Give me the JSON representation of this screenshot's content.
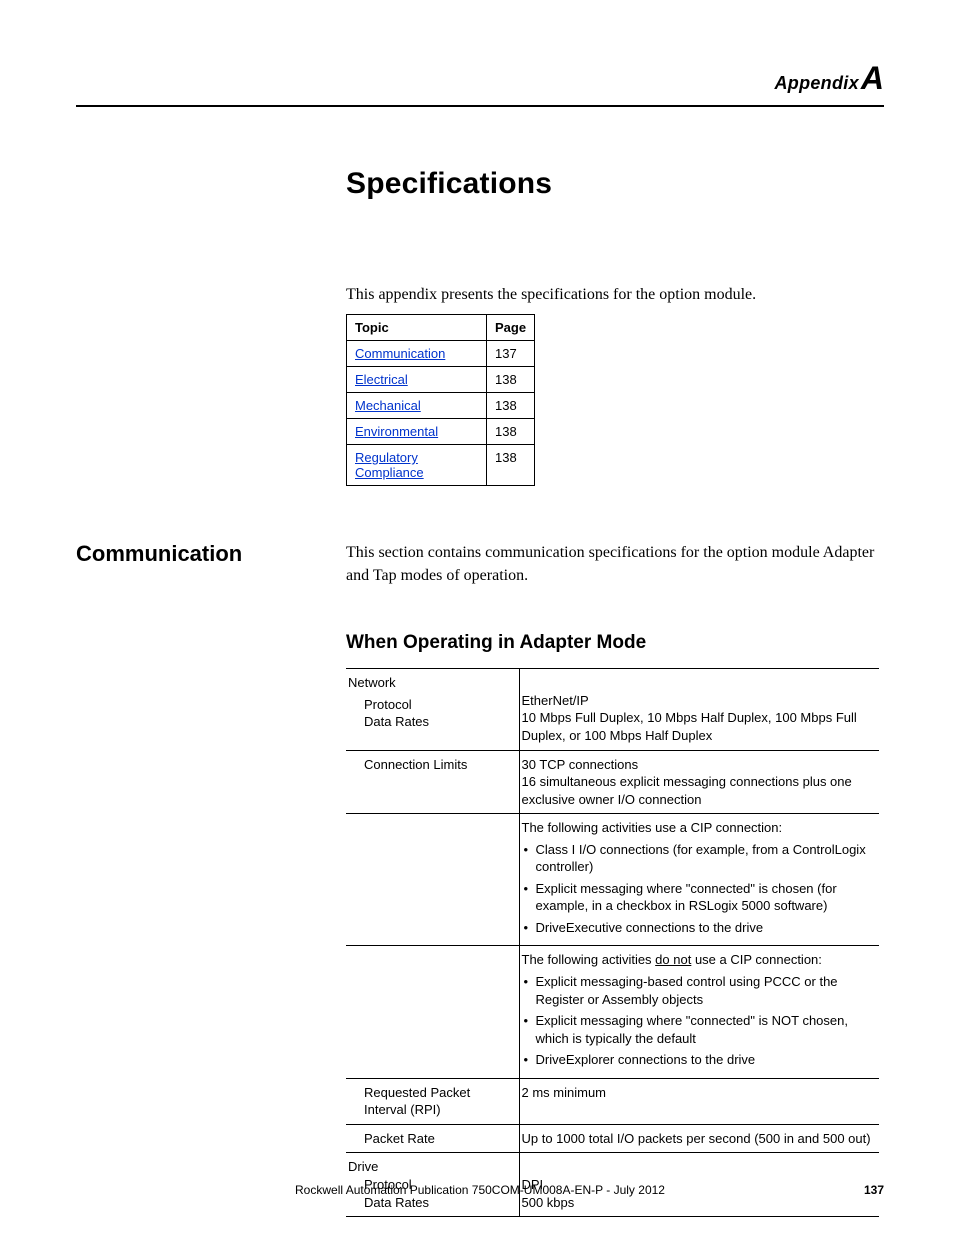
{
  "header": {
    "appendix_word": "Appendix",
    "appendix_letter": "A"
  },
  "chapter_title": "Specifications",
  "intro": "This appendix presents the specifications for the option module.",
  "topic_table": {
    "headers": {
      "topic": "Topic",
      "page": "Page"
    },
    "rows": [
      {
        "topic": "Communication",
        "page": "137"
      },
      {
        "topic": "Electrical",
        "page": "138"
      },
      {
        "topic": "Mechanical",
        "page": "138"
      },
      {
        "topic": "Environmental",
        "page": "138"
      },
      {
        "topic": "Regulatory Compliance",
        "page": "138"
      }
    ]
  },
  "section": {
    "label": "Communication",
    "text": "This section contains communication specifications for the option module Adapter and Tap modes of operation."
  },
  "subhead": "When Operating in Adapter Mode",
  "spec": {
    "network_label": "Network",
    "protocol_label": "Protocol",
    "protocol_value": "EtherNet/IP",
    "data_rates_label": "Data Rates",
    "data_rates_value": "10 Mbps Full Duplex, 10 Mbps Half Duplex, 100 Mbps Full Duplex, or 100 Mbps Half Duplex",
    "conn_limits_label": "Connection Limits",
    "conn_limits_line1": "30 TCP connections",
    "conn_limits_line2": "16 simultaneous explicit messaging connections plus one exclusive owner I/O connection",
    "cip_use_intro": "The following activities use a CIP connection:",
    "cip_use_bullets": [
      "Class I I/O connections (for example, from a ControlLogix controller)",
      "Explicit messaging where \"connected\" is chosen (for example, in a checkbox in RSLogix 5000 software)",
      "DriveExecutive connections to the drive"
    ],
    "cip_not_intro_pre": "The following activities ",
    "cip_not_intro_underline": "do not",
    "cip_not_intro_post": " use a CIP connection:",
    "cip_not_bullets": [
      "Explicit messaging-based control using PCCC or the Register or Assembly objects",
      "Explicit messaging where \"connected\" is NOT chosen, which is typically the default",
      "DriveExplorer connections to the drive"
    ],
    "rpi_label": "Requested Packet Interval (RPI)",
    "rpi_value": "2 ms minimum",
    "packet_rate_label": "Packet Rate",
    "packet_rate_value": "Up to 1000 total I/O packets per second (500 in and 500 out)",
    "drive_label": "Drive",
    "drive_protocol_label": "Protocol",
    "drive_protocol_value": "DPI",
    "drive_rates_label": "Data Rates",
    "drive_rates_value": "500 kbps"
  },
  "footer": {
    "text": "Rockwell Automation Publication 750COM-UM008A-EN-P - July 2012",
    "page": "137"
  }
}
